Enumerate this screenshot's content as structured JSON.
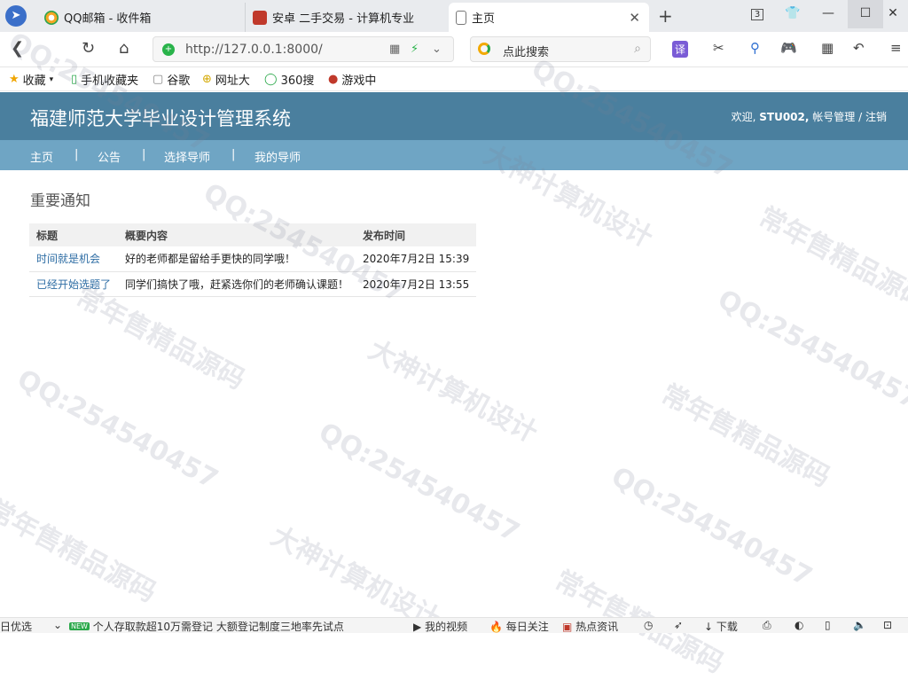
{
  "browser": {
    "tabs": [
      {
        "label": "QQ邮箱 - 收件箱"
      },
      {
        "label": "安卓 二手交易 - 计算机专业"
      },
      {
        "label": "主页"
      }
    ],
    "tab_count": "3",
    "url": "http://127.0.0.1:8000/",
    "search_placeholder": "点此搜索",
    "translate_label": "译",
    "bookmarks": [
      "收藏",
      "手机收藏夹",
      "谷歌",
      "网址大",
      "360搜",
      "游戏中"
    ]
  },
  "site": {
    "title": "福建师范大学毕业设计管理系统",
    "welcome": "欢迎,",
    "username": "STU002,",
    "account_link": "帐号管理",
    "separator": "/",
    "logout_link": "注销",
    "nav": [
      "主页",
      "公告",
      "选择导师",
      "我的导师"
    ],
    "nav_separator": "|"
  },
  "notices": {
    "section_title": "重要通知",
    "columns": [
      "标题",
      "概要内容",
      "发布时间"
    ],
    "rows": [
      {
        "title": "时间就是机会",
        "summary": "好的老师都是留给手更快的同学哦！",
        "time": "2020年7月2日 15:39"
      },
      {
        "title": "已经开始选题了",
        "summary": "同学们搞快了哦，赶紧选你们的老师确认课题！",
        "time": "2020年7月2日 13:55"
      }
    ]
  },
  "watermarks": [
    "QQ:254540457",
    "大神计算机设计",
    "常年售精品源码"
  ],
  "statusbar": {
    "items": [
      "日优选",
      "NEW",
      "个人存取款超10万需登记 大额登记制度三地率先试点",
      "我的视频",
      "每日关注",
      "热点资讯",
      "下载"
    ]
  }
}
